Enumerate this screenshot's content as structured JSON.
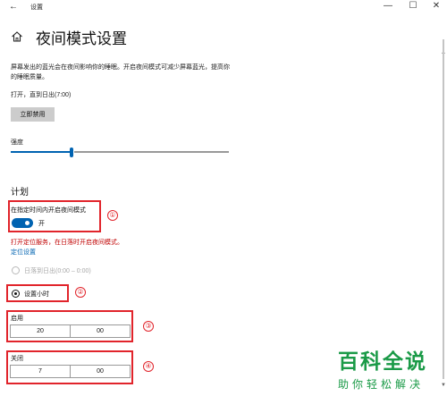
{
  "window": {
    "back_glyph": "←",
    "title": "设置",
    "minimize_glyph": "—",
    "maximize_glyph": "☐",
    "close_glyph": "✕"
  },
  "page": {
    "home_icon": "home-icon",
    "title": "夜间模式设置",
    "description": "屏幕发出的蓝光会在夜间影响你的睡眠。开启夜间模式可减少屏幕蓝光，提高你的睡眠质量。",
    "status": "打开，直到日出(7:00)",
    "disable_button": "立即禁用"
  },
  "intensity": {
    "label": "强度",
    "value_percent": 28
  },
  "schedule": {
    "heading": "计划",
    "toggle_title": "在指定时间内开启夜间模式",
    "toggle_state": "开",
    "toggle_on": true,
    "location_warning": "打开定位服务，在日落时开启夜间模式。",
    "location_link": "定位设置",
    "option_sunset": "日落到日出(0:00 – 0:00)",
    "option_set_hours": "设置小时",
    "on_label": "启用",
    "on_hour": "20",
    "on_minute": "00",
    "off_label": "关闭",
    "off_hour": "7",
    "off_minute": "00"
  },
  "annotations": {
    "n1": "①",
    "n2": "②",
    "n3": "③",
    "n4": "④"
  },
  "watermark": {
    "line1": "百科全说",
    "line2": "助你轻松解决"
  },
  "colors": {
    "accent": "#0063b1",
    "annotation_red": "#e1242b",
    "warning_red": "#c00000",
    "watermark_green": "#1a9a47"
  }
}
